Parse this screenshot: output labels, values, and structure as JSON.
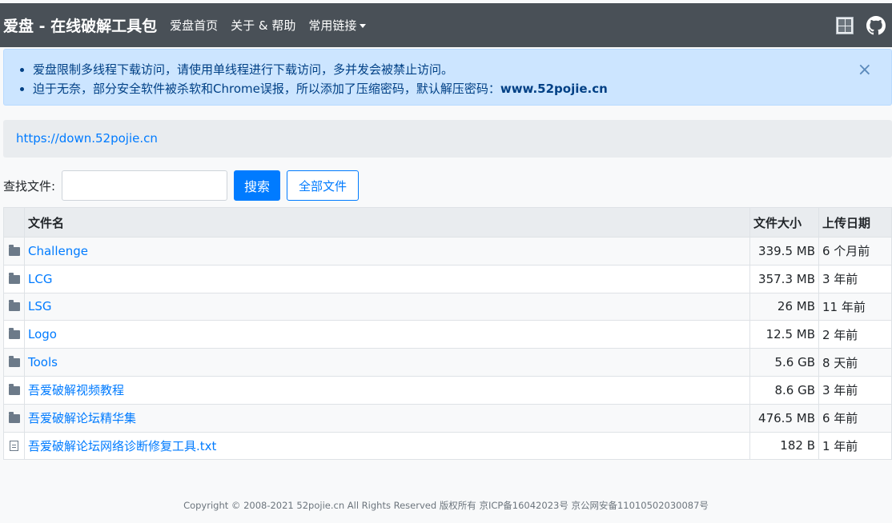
{
  "navbar": {
    "brand": "爱盘 - 在线破解工具包",
    "links": [
      "爱盘首页",
      "关于 & 帮助",
      "常用链接"
    ]
  },
  "alert": {
    "line1": "爱盘限制多线程下载访问，请使用单线程进行下载访问，多并发会被禁止访问。",
    "line2_prefix": "迫于无奈，部分安全软件被杀软和Chrome误报，所以添加了压缩密码，默认解压密码：",
    "line2_password": "www.52pojie.cn",
    "close": "×"
  },
  "breadcrumb": {
    "url": "https://down.52pojie.cn"
  },
  "search": {
    "label": "查找文件:",
    "placeholder": "",
    "search_button": "搜索",
    "all_button": "全部文件"
  },
  "table": {
    "headers": {
      "name": "文件名",
      "size": "文件大小",
      "date": "上传日期"
    },
    "rows": [
      {
        "icon": "folder-icon",
        "name": "Challenge",
        "size": "339.5 MB",
        "date": "6 个月前"
      },
      {
        "icon": "folder-icon",
        "name": "LCG",
        "size": "357.3 MB",
        "date": "3 年前"
      },
      {
        "icon": "folder-icon",
        "name": "LSG",
        "size": "26 MB",
        "date": "11 年前"
      },
      {
        "icon": "folder-icon",
        "name": "Logo",
        "size": "12.5 MB",
        "date": "2 年前"
      },
      {
        "icon": "folder-icon",
        "name": "Tools",
        "size": "5.6 GB",
        "date": "8 天前"
      },
      {
        "icon": "folder-icon",
        "name": "吾爱破解视频教程",
        "size": "8.6 GB",
        "date": "3 年前"
      },
      {
        "icon": "folder-icon",
        "name": "吾爱破解论坛精华集",
        "size": "476.5 MB",
        "date": "6 年前"
      },
      {
        "icon": "file-icon",
        "name": "吾爱破解论坛网络诊断修复工具.txt",
        "size": "182 B",
        "date": "1 年前"
      }
    ]
  },
  "footer": {
    "text": "Copyright © 2008-2021 52pojie.cn All Rights Reserved 版权所有 京ICP备16042023号 京公网安备11010502030087号"
  }
}
